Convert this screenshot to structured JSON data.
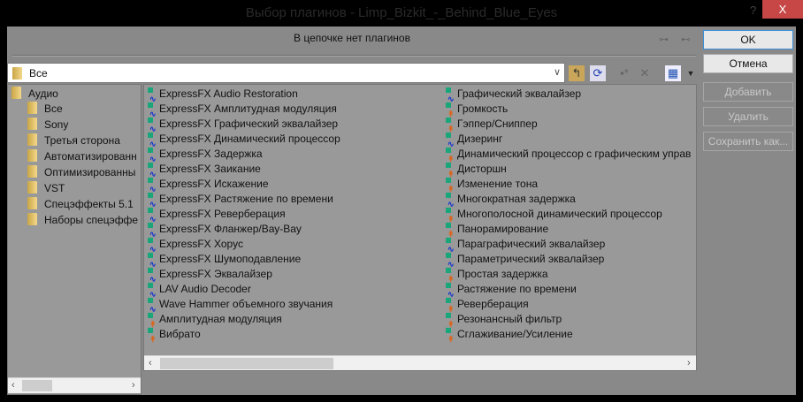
{
  "window": {
    "title": "Выбор плагинов - Limp_Bizkit_-_Behind_Blue_Eyes",
    "help": "?",
    "close": "X"
  },
  "chain": {
    "status": "В цепочке нет плагинов"
  },
  "combo": {
    "value": "Все"
  },
  "buttons": {
    "ok": "OK",
    "cancel": "Отмена",
    "add": "Добавить",
    "remove": "Удалить",
    "save": "Сохранить как..."
  },
  "tree": {
    "root": "Аудио",
    "items": [
      "Все",
      "Sony",
      "Третья сторона",
      "Автоматизированн",
      "Оптимизированны",
      "VST",
      "Спецэффекты 5.1",
      "Наборы спецэффе"
    ]
  },
  "plugins": {
    "left": [
      {
        "name": "ExpressFX Audio Restoration",
        "type": "blue"
      },
      {
        "name": "ExpressFX Амплитудная модуляция",
        "type": "blue"
      },
      {
        "name": "ExpressFX Графический эквалайзер",
        "type": "blue"
      },
      {
        "name": "ExpressFX Динамический процессор",
        "type": "blue"
      },
      {
        "name": "ExpressFX Задержка",
        "type": "blue"
      },
      {
        "name": "ExpressFX Заикание",
        "type": "blue"
      },
      {
        "name": "ExpressFX Искажение",
        "type": "blue"
      },
      {
        "name": "ExpressFX Растяжение по времени",
        "type": "blue"
      },
      {
        "name": "ExpressFX Реверберация",
        "type": "blue"
      },
      {
        "name": "ExpressFX Фланжер/Вау-Вау",
        "type": "blue"
      },
      {
        "name": "ExpressFX Хорус",
        "type": "blue"
      },
      {
        "name": "ExpressFX Шумоподавление",
        "type": "blue"
      },
      {
        "name": "ExpressFX Эквалайзер",
        "type": "blue"
      },
      {
        "name": "LAV Audio Decoder",
        "type": "blue"
      },
      {
        "name": "Wave Hammer объемного звучания",
        "type": "blue"
      },
      {
        "name": "Амплитудная модуляция",
        "type": "orange"
      },
      {
        "name": "Вибрато",
        "type": "orange"
      }
    ],
    "right": [
      {
        "name": "Графический эквалайзер",
        "type": "blue"
      },
      {
        "name": "Громкость",
        "type": "orange"
      },
      {
        "name": "Гэппер/Сниппер",
        "type": "orange"
      },
      {
        "name": "Дизеринг",
        "type": "blue"
      },
      {
        "name": "Динамический процессор с графическим управ",
        "type": "orange"
      },
      {
        "name": "Дисторшн",
        "type": "orange"
      },
      {
        "name": "Изменение тона",
        "type": "orange"
      },
      {
        "name": "Многократная задержка",
        "type": "blue"
      },
      {
        "name": "Многополосной динамический процессор",
        "type": "orange"
      },
      {
        "name": "Панорамирование",
        "type": "orange"
      },
      {
        "name": "Параграфический эквалайзер",
        "type": "blue"
      },
      {
        "name": "Параметрический эквалайзер",
        "type": "blue"
      },
      {
        "name": "Простая задержка",
        "type": "orange"
      },
      {
        "name": "Растяжение по времени",
        "type": "blue"
      },
      {
        "name": "Реверберация",
        "type": "orange"
      },
      {
        "name": "Резонансный фильтр",
        "type": "orange"
      },
      {
        "name": "Сглаживание/Усиление",
        "type": "orange"
      }
    ]
  }
}
